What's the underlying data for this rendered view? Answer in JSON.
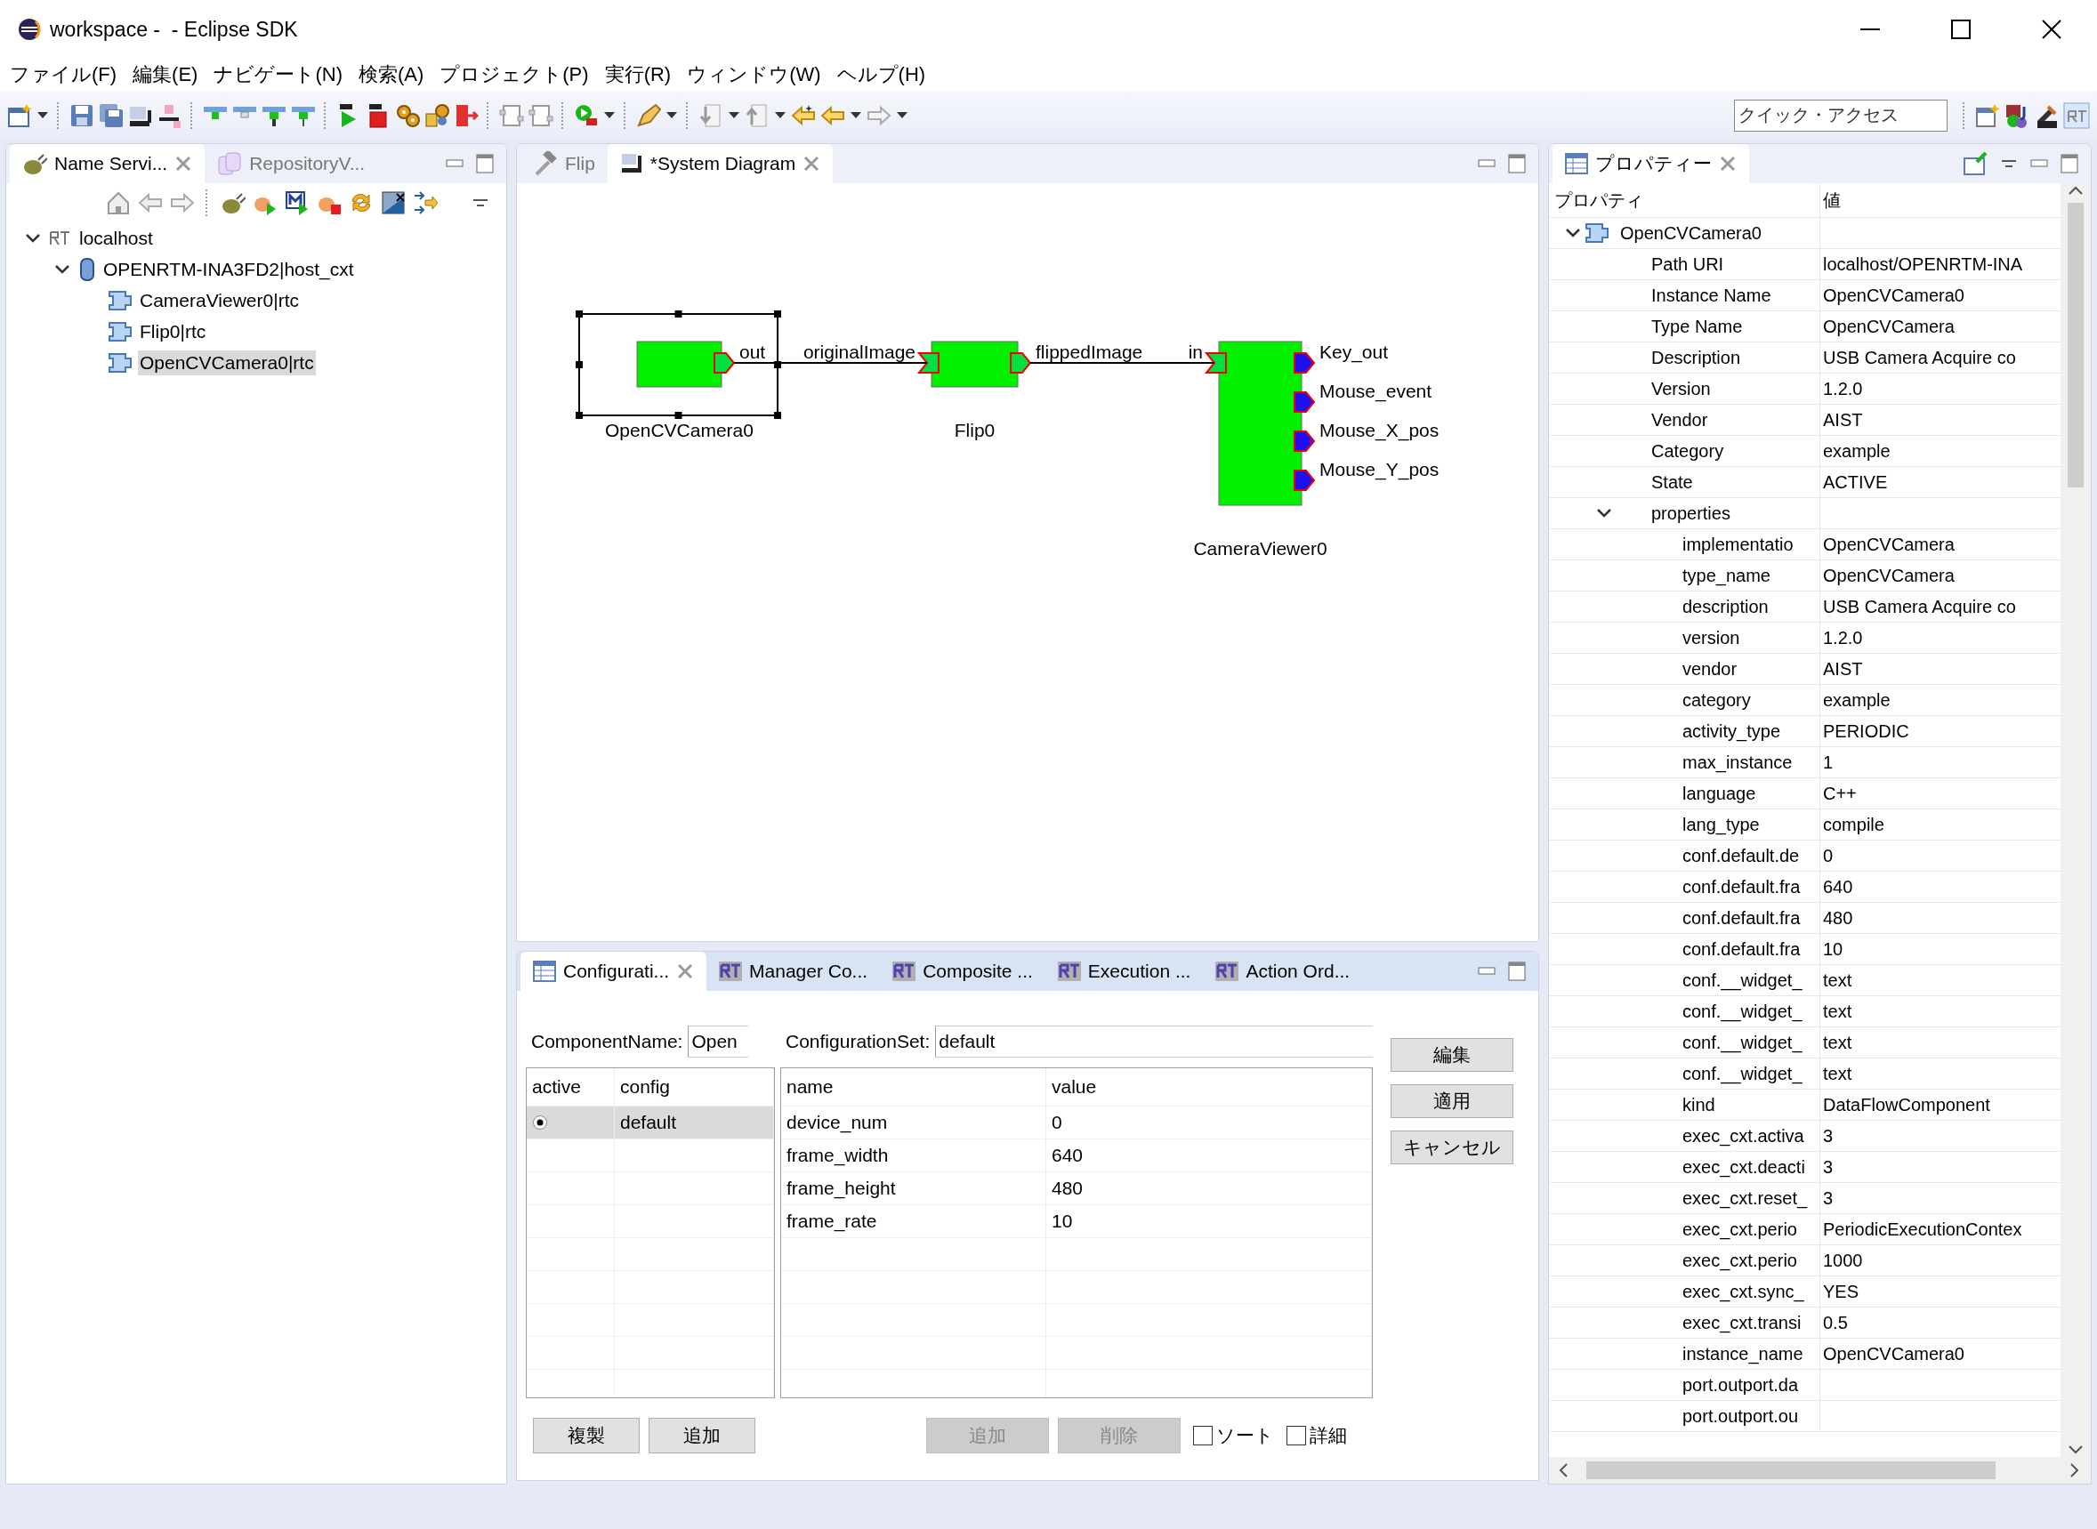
{
  "window": {
    "title": "workspace -  - Eclipse SDK"
  },
  "menu": [
    "ファイル(F)",
    "編集(E)",
    "ナビゲート(N)",
    "検索(A)",
    "プロジェクト(P)",
    "実行(R)",
    "ウィンドウ(W)",
    "ヘルプ(H)"
  ],
  "quick_access": {
    "placeholder": "クイック・アクセス"
  },
  "name_service": {
    "tabs": [
      {
        "label": "Name Servi...",
        "selected": true
      },
      {
        "label": "RepositoryV...",
        "selected": false
      }
    ],
    "tree": [
      {
        "label": "localhost",
        "kind": "nameserver",
        "selected": false,
        "expanded": true,
        "children": [
          {
            "label": "OPENRTM-INA3FD2|host_cxt",
            "kind": "host",
            "selected": false,
            "expanded": true,
            "children": [
              {
                "label": "CameraViewer0|rtc",
                "kind": "component",
                "selected": false
              },
              {
                "label": "Flip0|rtc",
                "kind": "component",
                "selected": false
              },
              {
                "label": "OpenCVCamera0|rtc",
                "kind": "component",
                "selected": true
              }
            ]
          }
        ]
      }
    ]
  },
  "editor": {
    "tabs": [
      {
        "label": "Flip",
        "selected": false
      },
      {
        "label": "*System Diagram",
        "selected": true
      }
    ],
    "components": [
      {
        "name": "OpenCVCamera0",
        "selected": true,
        "outports": [
          {
            "name": "out",
            "connected": true
          }
        ]
      },
      {
        "name": "Flip0",
        "selected": false,
        "inports": [
          {
            "name": "originalImage",
            "connected": true
          }
        ],
        "outports": [
          {
            "name": "flippedImage",
            "connected": true
          }
        ]
      },
      {
        "name": "CameraViewer0",
        "selected": false,
        "inports": [
          {
            "name": "in",
            "connected": true
          }
        ],
        "outports": [
          {
            "name": "Key_out",
            "connected": false
          },
          {
            "name": "Mouse_event",
            "connected": false
          },
          {
            "name": "Mouse_X_pos",
            "connected": false
          },
          {
            "name": "Mouse_Y_pos",
            "connected": false
          }
        ]
      }
    ]
  },
  "configuration": {
    "tabs": [
      {
        "label": "Configurati...",
        "selected": true
      },
      {
        "label": "Manager Co...",
        "selected": false
      },
      {
        "label": "Composite ...",
        "selected": false
      },
      {
        "label": "Execution ...",
        "selected": false
      },
      {
        "label": "Action Ord...",
        "selected": false
      }
    ],
    "component_name": {
      "label": "ComponentName:",
      "value": "Open"
    },
    "configuration_set": {
      "label": "ConfigurationSet:",
      "value": "default"
    },
    "sets": {
      "columns": [
        "active",
        "config"
      ],
      "rows": [
        {
          "active": true,
          "name": "default",
          "selected": true
        }
      ]
    },
    "params": {
      "columns": [
        "name",
        "value"
      ],
      "rows": [
        [
          "device_num",
          "0"
        ],
        [
          "frame_width",
          "640"
        ],
        [
          "frame_height",
          "480"
        ],
        [
          "frame_rate",
          "10"
        ]
      ]
    },
    "side_buttons": [
      "編集",
      "適用",
      "キャンセル"
    ],
    "set_buttons": [
      "複製",
      "追加"
    ],
    "param_buttons": [
      {
        "label": "追加",
        "disabled": true
      },
      {
        "label": "削除",
        "disabled": true
      }
    ],
    "options": [
      {
        "label": "ソート",
        "checked": false
      },
      {
        "label": "詳細",
        "checked": false
      }
    ]
  },
  "properties": {
    "tab": "プロパティー",
    "columns": [
      "プロパティ",
      "値"
    ],
    "tree": [
      {
        "name": "OpenCVCamera0",
        "expanded": true,
        "children": [
          {
            "name": "Path URI",
            "value": "localhost/OPENRTM-INA"
          },
          {
            "name": "Instance Name",
            "value": "OpenCVCamera0"
          },
          {
            "name": "Type Name",
            "value": "OpenCVCamera"
          },
          {
            "name": "Description",
            "value": "USB Camera Acquire co"
          },
          {
            "name": "Version",
            "value": "1.2.0"
          },
          {
            "name": "Vendor",
            "value": "AIST"
          },
          {
            "name": "Category",
            "value": "example"
          },
          {
            "name": "State",
            "value": "ACTIVE"
          },
          {
            "name": "properties",
            "expanded": true,
            "children": [
              {
                "name": "implementatio",
                "value": "OpenCVCamera"
              },
              {
                "name": "type_name",
                "value": "OpenCVCamera"
              },
              {
                "name": "description",
                "value": "USB Camera Acquire co"
              },
              {
                "name": "version",
                "value": "1.2.0"
              },
              {
                "name": "vendor",
                "value": "AIST"
              },
              {
                "name": "category",
                "value": "example"
              },
              {
                "name": "activity_type",
                "value": "PERIODIC"
              },
              {
                "name": "max_instance",
                "value": "1"
              },
              {
                "name": "language",
                "value": "C++"
              },
              {
                "name": "lang_type",
                "value": "compile"
              },
              {
                "name": "conf.default.de",
                "value": "0"
              },
              {
                "name": "conf.default.fra",
                "value": "640"
              },
              {
                "name": "conf.default.fra",
                "value": "480"
              },
              {
                "name": "conf.default.fra",
                "value": "10"
              },
              {
                "name": "conf.__widget_",
                "value": "text"
              },
              {
                "name": "conf.__widget_",
                "value": "text"
              },
              {
                "name": "conf.__widget_",
                "value": "text"
              },
              {
                "name": "conf.__widget_",
                "value": "text"
              },
              {
                "name": "kind",
                "value": "DataFlowComponent"
              },
              {
                "name": "exec_cxt.activa",
                "value": "3"
              },
              {
                "name": "exec_cxt.deacti",
                "value": "3"
              },
              {
                "name": "exec_cxt.reset_",
                "value": "3"
              },
              {
                "name": "exec_cxt.perio",
                "value": "PeriodicExecutionContex"
              },
              {
                "name": "exec_cxt.perio",
                "value": "1000"
              },
              {
                "name": "exec_cxt.sync_",
                "value": "YES"
              },
              {
                "name": "exec_cxt.transi",
                "value": "0.5"
              },
              {
                "name": "instance_name",
                "value": "OpenCVCamera0"
              },
              {
                "name": "port.outport.da"
              },
              {
                "name": "port.outport.ou"
              }
            ]
          }
        ]
      }
    ]
  }
}
